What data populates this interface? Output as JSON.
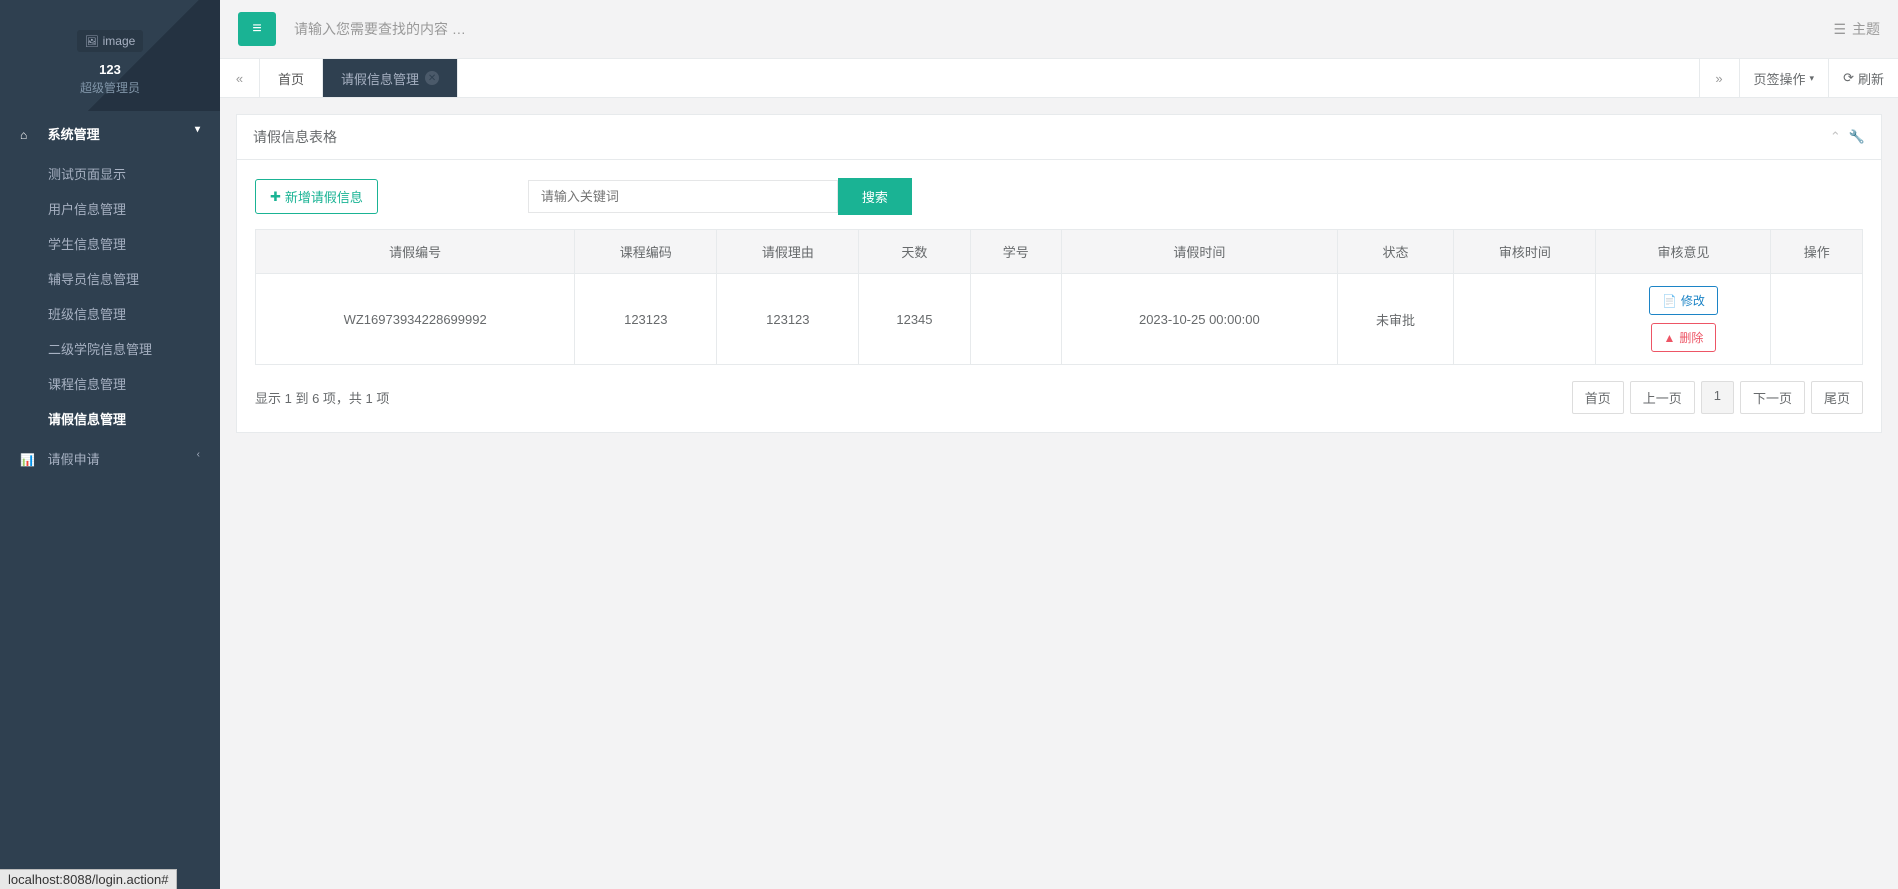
{
  "profile": {
    "img_label": "image",
    "name": "123",
    "role": "超级管理员"
  },
  "sidebar": {
    "groups": [
      {
        "icon": "⌂",
        "label": "系统管理",
        "expanded": true,
        "items": [
          {
            "label": "测试页面显示"
          },
          {
            "label": "用户信息管理"
          },
          {
            "label": "学生信息管理"
          },
          {
            "label": "辅导员信息管理"
          },
          {
            "label": "班级信息管理"
          },
          {
            "label": "二级学院信息管理"
          },
          {
            "label": "课程信息管理"
          },
          {
            "label": "请假信息管理",
            "active": true
          }
        ]
      },
      {
        "icon": "📊",
        "label": "请假申请",
        "expanded": false
      }
    ]
  },
  "topbar": {
    "search_placeholder": "请输入您需要查找的内容 …",
    "theme": "主题"
  },
  "tabs": {
    "home": "首页",
    "active": "请假信息管理",
    "ops": "页签操作",
    "refresh": "刷新"
  },
  "panel": {
    "title": "请假信息表格"
  },
  "toolbar": {
    "add": "新增请假信息",
    "search_ph": "请输入关键词",
    "search": "搜索"
  },
  "table": {
    "headers": [
      "请假编号",
      "课程编码",
      "请假理由",
      "天数",
      "学号",
      "请假时间",
      "状态",
      "审核时间",
      "审核意见",
      "操作"
    ],
    "rows": [
      {
        "cells": [
          "WZ16973934228699992",
          "123123",
          "123123",
          "12345",
          "",
          "2023-10-25 00:00:00",
          "未审批",
          "",
          ""
        ]
      }
    ],
    "edit": "修改",
    "del": "删除",
    "info": "显示 1 到 6 项，共 1 项",
    "pager": {
      "first": "首页",
      "prev": "上一页",
      "cur": "1",
      "next": "下一页",
      "last": "尾页"
    }
  },
  "statusbar": "localhost:8088/login.action#"
}
